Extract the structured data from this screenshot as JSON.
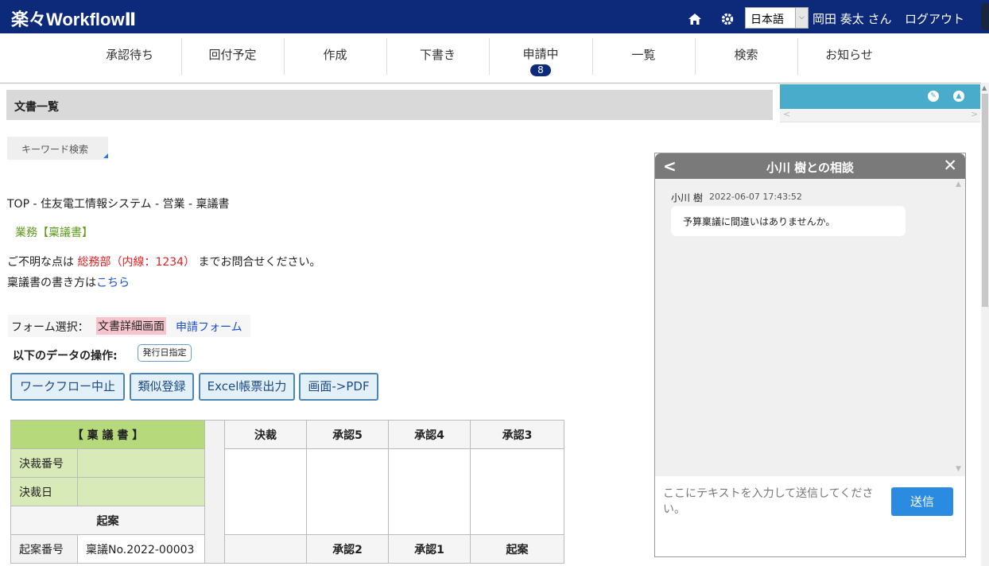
{
  "header": {
    "logo_text": "楽々WorkflowⅡ",
    "language": "日本語",
    "user_name": "岡田 奏太 さん",
    "logout_label": "ログアウト"
  },
  "nav": {
    "items": [
      {
        "label": "承認待ち"
      },
      {
        "label": "回付予定"
      },
      {
        "label": "作成"
      },
      {
        "label": "下書き"
      },
      {
        "label": "申請中",
        "badge": "8"
      },
      {
        "label": "一覧"
      },
      {
        "label": "検索"
      },
      {
        "label": "お知らせ"
      }
    ]
  },
  "page": {
    "section_title": "文書一覧",
    "keyword_search_label": "キーワード検索",
    "breadcrumb_prefix": "TOP - 住友電工情報システム - 営業 - ",
    "breadcrumb_current": "稟議書",
    "category": "業務【稟議書】",
    "contact_prefix": "ご不明な点は",
    "contact_dept": "総務部（内線：1234）",
    "contact_suffix": "までお問合せください。",
    "howto_prefix": "稟議書の書き方は",
    "howto_link": "こちら",
    "form_select_label": "フォーム選択：",
    "form_current": "文書詳細画面",
    "form_other": "申請フォーム",
    "ops_label": "以下のデータの操作:",
    "date_spec_button": "発行日指定",
    "actions": [
      "ワークフロー中止",
      "類似登録",
      "Excel帳票出力",
      "画面->PDF"
    ]
  },
  "document": {
    "title": "【 稟 議 書 】",
    "decision_no_label": "決裁番号",
    "decision_no": "",
    "decision_date_label": "決裁日",
    "decision_date": "",
    "draft_section": "起案",
    "draft_no_label": "起案番号",
    "draft_no": "稟議No.2022-00003",
    "approvals_top": [
      "決裁",
      "承認5",
      "承認4",
      "承認3"
    ],
    "approvals_bottom": [
      "",
      "承認2",
      "承認1",
      "起案"
    ]
  },
  "chat": {
    "title": "小川 樹との相談",
    "messages": [
      {
        "author": "小川 樹",
        "time": "2022-06-07 17:43:52",
        "text": "予算稟議に間違いはありませんか。"
      }
    ],
    "input_placeholder": "ここにテキストを入力して送信してください。",
    "send_label": "送信"
  },
  "colors": {
    "header_bg": "#0d2a7a",
    "accent": "#4aaccb",
    "table_green": "#b6d97b",
    "send_button": "#2a8be0"
  },
  "icons": [
    "home-icon",
    "gear-icon",
    "chevron-down-icon",
    "pin-icon",
    "collapse-icon",
    "back-icon",
    "close-icon"
  ]
}
